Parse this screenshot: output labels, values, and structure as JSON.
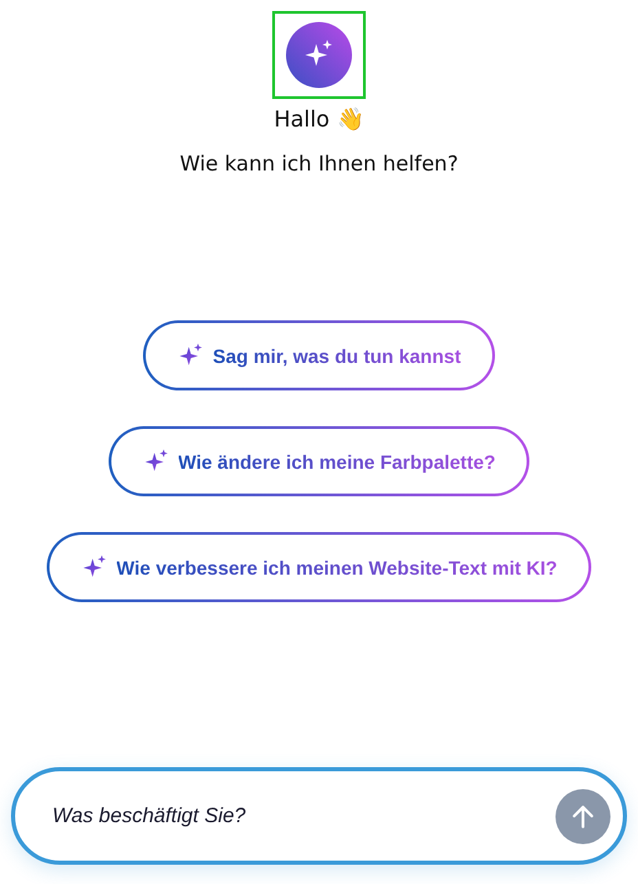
{
  "header": {
    "greeting": "Hallo 👋",
    "subtitle": "Wie kann ich Ihnen helfen?"
  },
  "suggestions": [
    {
      "label": "Sag mir, was du tun kannst"
    },
    {
      "label": "Wie ändere ich meine Farbpalette?"
    },
    {
      "label": "Wie verbessere ich meinen Website-Text mit KI?"
    }
  ],
  "composer": {
    "placeholder": "Was beschäftigt Sie?",
    "send_disabled": true
  }
}
